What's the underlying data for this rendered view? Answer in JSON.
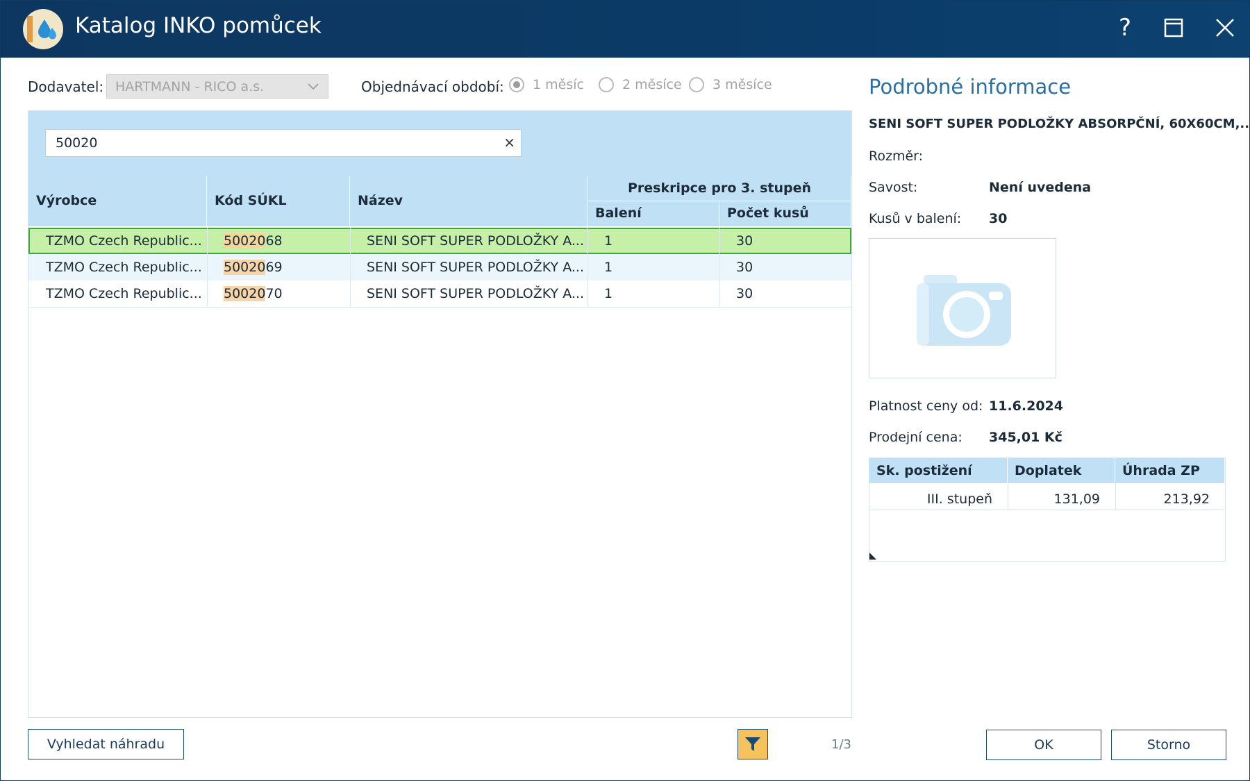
{
  "window": {
    "title": "Katalog INKO pomůcek",
    "help_label": "?"
  },
  "filters": {
    "supplier_label": "Dodavatel:",
    "supplier_value": "HARTMANN - RICO a.s.",
    "period_label": "Objednávací období:",
    "period_options": [
      "1 měsíc",
      "2 měsíce",
      "3 měsíce"
    ],
    "period_selected": "1 měsíc"
  },
  "search": {
    "value": "50020",
    "clear_label": "×"
  },
  "grid": {
    "headers": {
      "manufacturer": "Výrobce",
      "sukl_code": "Kód SÚKL",
      "name": "Název",
      "prescription_group": "Preskripce pro 3. stupeň",
      "packages": "Balení",
      "pieces": "Počet kusů"
    },
    "rows": [
      {
        "manufacturer": "TZMO Czech Republic...",
        "code_match": "50020",
        "code_rest": "68",
        "name": "SENI SOFT SUPER PODLOŽKY A...",
        "packages": "1",
        "pieces": "30",
        "selected": true
      },
      {
        "manufacturer": "TZMO Czech Republic...",
        "code_match": "50020",
        "code_rest": "69",
        "name": "SENI SOFT SUPER PODLOŽKY A...",
        "packages": "1",
        "pieces": "30",
        "selected": false
      },
      {
        "manufacturer": "TZMO Czech Republic...",
        "code_match": "50020",
        "code_rest": "70",
        "name": "SENI SOFT SUPER PODLOŽKY A...",
        "packages": "1",
        "pieces": "30",
        "selected": false
      }
    ]
  },
  "footer": {
    "find_replacement_label": "Vyhledat náhradu",
    "counter": "1/3",
    "ok_label": "OK",
    "cancel_label": "Storno"
  },
  "detail": {
    "title": "Podrobné informace",
    "product_name": "SENI SOFT SUPER PODLOŽKY ABSORPČNÍ, 60X60CM,...",
    "size_label": "Rozměr:",
    "size_value": "",
    "absorbency_label": "Savost:",
    "absorbency_value": "Není uvedena",
    "pieces_label": "Kusů v balení:",
    "pieces_value": "30",
    "price_valid_label": "Platnost ceny od:",
    "price_valid_value": "11.6.2024",
    "price_label": "Prodejní cena:",
    "price_value": "345,01 Kč",
    "price_table": {
      "headers": [
        "Sk. postižení",
        "Doplatek",
        "Úhrada ZP"
      ],
      "rows": [
        [
          "III. stupeň",
          "131,09",
          "213,92"
        ]
      ]
    }
  },
  "colors": {
    "titlebar": "#0d3760",
    "header_bg": "#c0e1f5",
    "selected_row": "#c6f0a8",
    "selected_border": "#43a63a",
    "match_highlight": "#f8d4a6",
    "filter_button": "#f6c25c",
    "detail_title": "#2a6ea6"
  },
  "icons": {
    "app": "water-drops-icon",
    "help": "help-icon",
    "maximize": "maximize-icon",
    "close": "close-icon",
    "dropdown": "chevron-down-icon",
    "clear": "clear-icon",
    "filter": "filter-icon",
    "photo_placeholder": "camera-icon"
  }
}
